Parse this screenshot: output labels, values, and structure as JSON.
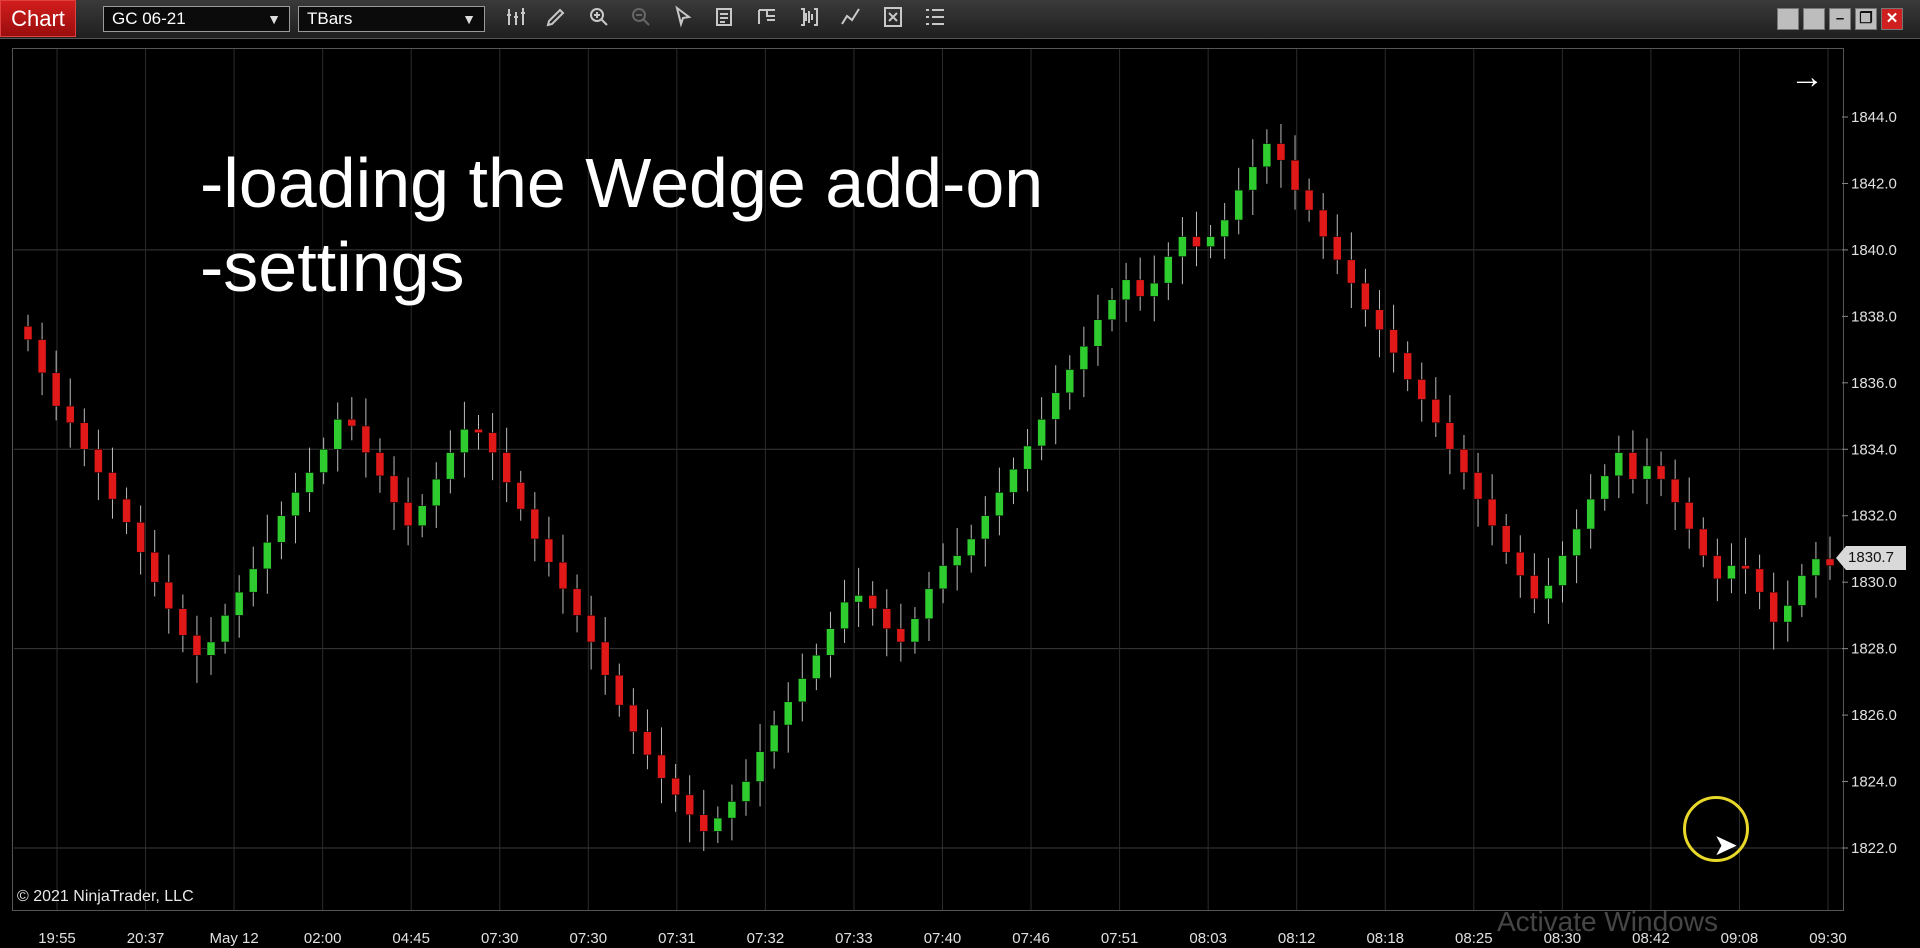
{
  "window": {
    "title_tab": "Chart",
    "instrument": "GC 06-21",
    "bar_type": "TBars"
  },
  "toolbar_icons": [
    "bar-style-icon",
    "draw-tool-icon",
    "zoom-in-icon",
    "zoom-out-icon",
    "pointer-icon",
    "data-box-icon",
    "properties-icon",
    "strategies-icon",
    "indicators-icon",
    "templates-icon",
    "more-icon"
  ],
  "overlay_text": [
    "-loading the Wedge add-on",
    "-settings"
  ],
  "copyright": "© 2021 NinjaTrader, LLC",
  "watermark": "Activate Windows",
  "current_price_label": "1830.7",
  "colors": {
    "up": "#2ecc2e",
    "down": "#e01818",
    "grid": "#3a3a3a",
    "background": "#000000"
  },
  "chart_data": {
    "type": "candlestick",
    "instrument": "GC 06-21",
    "ylim": [
      1820.0,
      1846.0
    ],
    "y_ticks": [
      "1844.0",
      "1842.0",
      "1840.0",
      "1838.0",
      "1836.0",
      "1834.0",
      "1832.0",
      "1830.0",
      "1828.0",
      "1826.0",
      "1824.0",
      "1822.0"
    ],
    "x_tick_labels": [
      "19:55",
      "20:37",
      "May 12",
      "02:00",
      "04:45",
      "07:30",
      "07:30",
      "07:31",
      "07:32",
      "07:33",
      "07:40",
      "07:46",
      "07:51",
      "08:03",
      "08:12",
      "08:18",
      "08:25",
      "08:30",
      "08:42",
      "09:08",
      "09:30"
    ],
    "closes": [
      1837.3,
      1836.3,
      1835.3,
      1834.8,
      1834.0,
      1833.3,
      1832.5,
      1831.8,
      1830.9,
      1830.0,
      1829.2,
      1828.4,
      1827.8,
      1828.2,
      1829.0,
      1829.7,
      1830.4,
      1831.2,
      1832.0,
      1832.7,
      1833.3,
      1834.0,
      1834.9,
      1834.7,
      1833.9,
      1833.2,
      1832.4,
      1831.7,
      1832.3,
      1833.1,
      1833.9,
      1834.6,
      1834.5,
      1833.9,
      1833.0,
      1832.2,
      1831.3,
      1830.6,
      1829.8,
      1829.0,
      1828.2,
      1827.2,
      1826.3,
      1825.5,
      1824.8,
      1824.1,
      1823.6,
      1823.0,
      1822.5,
      1822.9,
      1823.4,
      1824.0,
      1824.9,
      1825.7,
      1826.4,
      1827.1,
      1827.8,
      1828.6,
      1829.4,
      1829.6,
      1829.2,
      1828.6,
      1828.2,
      1828.9,
      1829.8,
      1830.5,
      1830.8,
      1831.3,
      1832.0,
      1832.7,
      1833.4,
      1834.1,
      1834.9,
      1835.7,
      1836.4,
      1837.1,
      1837.9,
      1838.5,
      1839.1,
      1838.6,
      1839.0,
      1839.8,
      1840.4,
      1840.1,
      1840.4,
      1840.9,
      1841.8,
      1842.5,
      1843.2,
      1842.7,
      1841.8,
      1841.2,
      1840.4,
      1839.7,
      1839.0,
      1838.2,
      1837.6,
      1836.9,
      1836.1,
      1835.5,
      1834.8,
      1834.0,
      1833.3,
      1832.5,
      1831.7,
      1830.9,
      1830.2,
      1829.5,
      1829.9,
      1830.8,
      1831.6,
      1832.5,
      1833.2,
      1833.9,
      1833.1,
      1833.5,
      1833.1,
      1832.4,
      1831.6,
      1830.8,
      1830.1,
      1830.5,
      1830.4,
      1829.7,
      1828.8,
      1829.3,
      1830.2,
      1830.7,
      1830.5
    ]
  }
}
